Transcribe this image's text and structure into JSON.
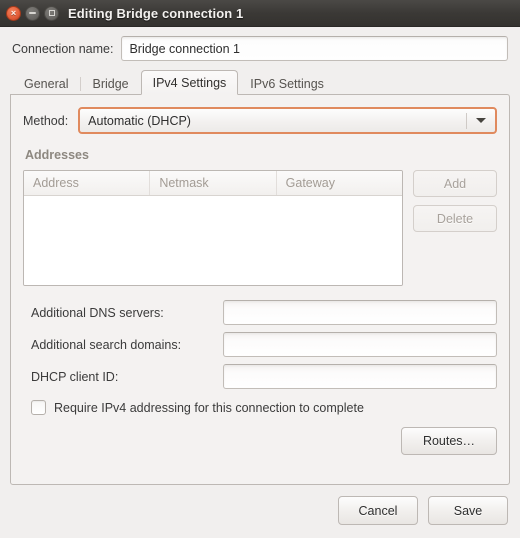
{
  "window": {
    "title": "Editing Bridge connection 1",
    "controls": [
      {
        "name": "close",
        "glyph": "×"
      },
      {
        "name": "minimize",
        "glyph": "−"
      },
      {
        "name": "maximize",
        "glyph": "□"
      }
    ]
  },
  "connection": {
    "label": "Connection name:",
    "value": "Bridge connection 1"
  },
  "tabs": [
    {
      "label": "General",
      "active": false
    },
    {
      "label": "Bridge",
      "active": false
    },
    {
      "label": "IPv4 Settings",
      "active": true
    },
    {
      "label": "IPv6 Settings",
      "active": false
    }
  ],
  "method": {
    "label": "Method:",
    "value": "Automatic (DHCP)",
    "focus_color": "#e08a5e",
    "arrow_icon": "chevron-down-icon"
  },
  "addresses": {
    "heading": "Addresses",
    "columns": [
      "Address",
      "Netmask",
      "Gateway"
    ],
    "rows": [],
    "add_label": "Add",
    "delete_label": "Delete",
    "add_enabled": false,
    "delete_enabled": false
  },
  "fields": [
    {
      "label": "Additional DNS servers:",
      "value": "",
      "placeholder": ""
    },
    {
      "label": "Additional search domains:",
      "value": "",
      "placeholder": ""
    },
    {
      "label": "DHCP client ID:",
      "value": "",
      "placeholder": ""
    }
  ],
  "require_ipv4": {
    "label": "Require IPv4 addressing for this connection to complete",
    "checked": false
  },
  "routes": {
    "label": "Routes…"
  },
  "actions": {
    "cancel_label": "Cancel",
    "save_label": "Save"
  },
  "colors": {
    "titlebar": "#3b3936",
    "background": "#f1efee",
    "panel": "#f4f2f1",
    "accent": "#e08a5e",
    "close_button": "#e4603b"
  }
}
